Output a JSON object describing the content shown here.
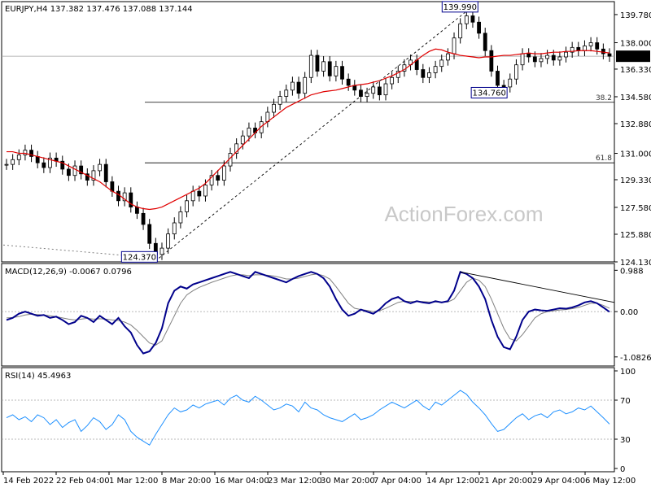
{
  "chart_data": [
    {
      "type": "candlestick",
      "header": "EURJPY,H4  137.382 137.476 137.088 137.144",
      "watermark": "ActionForex.com",
      "ylim": [
        124.13,
        140.6
      ],
      "y_ticks": [
        "139.780",
        "138.000",
        "136.330",
        "134.580",
        "132.880",
        "131.000",
        "129.330",
        "127.580",
        "125.880",
        "124.130"
      ],
      "last_price_label": "137.144",
      "last_price": 137.144,
      "annotations": [
        {
          "label": "139.990",
          "value": 139.99
        },
        {
          "label": "134.760",
          "value": 134.76
        },
        {
          "label": "124.370",
          "value": 124.37
        }
      ],
      "fib_levels": [
        {
          "label": "38.2",
          "value": 134.23
        },
        {
          "label": "61.8",
          "value": 130.4
        }
      ],
      "close_series": [
        130.3,
        130.6,
        130.9,
        131.2,
        130.8,
        130.4,
        130.1,
        130.7,
        130.5,
        130.0,
        129.6,
        130.2,
        129.7,
        129.3,
        129.9,
        130.3,
        129.2,
        128.6,
        128.0,
        128.5,
        127.6,
        127.2,
        126.5,
        125.3,
        124.6,
        125.0,
        125.9,
        126.6,
        127.3,
        128.0,
        128.6,
        128.3,
        129.0,
        129.6,
        129.3,
        130.2,
        131.0,
        131.6,
        132.1,
        132.6,
        132.3,
        133.0,
        133.6,
        134.1,
        134.6,
        135.0,
        135.5,
        134.8,
        135.8,
        137.2,
        136.2,
        136.8,
        135.9,
        136.5,
        135.7,
        135.3,
        135.0,
        134.6,
        134.8,
        135.2,
        134.7,
        135.4,
        135.8,
        136.2,
        136.6,
        136.9,
        136.3,
        135.8,
        136.1,
        136.5,
        136.9,
        137.3,
        138.3,
        139.2,
        139.7,
        139.3,
        138.6,
        137.5,
        136.2,
        135.3,
        135.2,
        135.7,
        136.6,
        137.3,
        137.1,
        136.8,
        137.0,
        137.2,
        136.9,
        137.1,
        137.4,
        137.7,
        137.5,
        137.8,
        138.0,
        137.6,
        137.3,
        137.144
      ],
      "ma_series": [
        131.1,
        131.1,
        131.0,
        131.0,
        130.9,
        130.8,
        130.7,
        130.6,
        130.5,
        130.4,
        130.2,
        130.0,
        129.8,
        129.6,
        129.4,
        129.2,
        128.9,
        128.6,
        128.4,
        128.1,
        127.8,
        127.6,
        127.5,
        127.45,
        127.5,
        127.6,
        127.8,
        128.0,
        128.2,
        128.4,
        128.6,
        128.8,
        129.1,
        129.5,
        129.9,
        130.3,
        130.7,
        131.1,
        131.5,
        131.9,
        132.3,
        132.7,
        133.0,
        133.3,
        133.6,
        133.9,
        134.1,
        134.3,
        134.5,
        134.7,
        134.8,
        134.9,
        134.95,
        135.0,
        135.1,
        135.2,
        135.3,
        135.35,
        135.4,
        135.5,
        135.6,
        135.75,
        135.9,
        136.1,
        136.3,
        136.6,
        136.9,
        137.2,
        137.45,
        137.6,
        137.55,
        137.4,
        137.3,
        137.2,
        137.15,
        137.1,
        137.05,
        137.1,
        137.1,
        137.15,
        137.2,
        137.2,
        137.25,
        137.3,
        137.35,
        137.3,
        137.3,
        137.35,
        137.4,
        137.4,
        137.45,
        137.45,
        137.5,
        137.5,
        137.5,
        137.45,
        137.4,
        137.35
      ]
    },
    {
      "type": "line",
      "header": "MACD(12,26,9) -0.0067 0.0796",
      "ylim": [
        -1.3,
        1.15
      ],
      "y_ticks": [
        {
          "label": "0.988",
          "value": 0.988
        },
        {
          "label": "0.00",
          "value": 0.0
        },
        {
          "label": "-1.0826",
          "value": -1.0826
        }
      ],
      "series": [
        {
          "values": [
            -0.2,
            -0.15,
            -0.05,
            0.0,
            -0.05,
            -0.1,
            -0.08,
            -0.15,
            -0.12,
            -0.2,
            -0.3,
            -0.25,
            -0.1,
            -0.15,
            -0.25,
            -0.1,
            -0.2,
            -0.3,
            -0.15,
            -0.35,
            -0.5,
            -0.8,
            -1.0,
            -0.95,
            -0.75,
            -0.4,
            0.2,
            0.5,
            0.6,
            0.55,
            0.65,
            0.7,
            0.75,
            0.8,
            0.85,
            0.9,
            0.95,
            0.9,
            0.85,
            0.8,
            0.95,
            0.9,
            0.85,
            0.8,
            0.75,
            0.7,
            0.78,
            0.85,
            0.9,
            0.95,
            0.9,
            0.8,
            0.6,
            0.3,
            0.05,
            -0.1,
            -0.05,
            0.05,
            0.0,
            -0.05,
            0.05,
            0.2,
            0.3,
            0.35,
            0.25,
            0.2,
            0.25,
            0.22,
            0.2,
            0.25,
            0.22,
            0.25,
            0.5,
            0.95,
            0.9,
            0.8,
            0.6,
            0.3,
            -0.2,
            -0.6,
            -0.85,
            -0.9,
            -0.6,
            -0.2,
            0.0,
            0.05,
            0.03,
            0.02,
            0.05,
            0.08,
            0.07,
            0.1,
            0.15,
            0.22,
            0.25,
            0.2,
            0.1,
            -0.0067
          ]
        },
        {
          "values": [
            -0.15,
            -0.14,
            -0.12,
            -0.08,
            -0.06,
            -0.07,
            -0.08,
            -0.1,
            -0.12,
            -0.15,
            -0.18,
            -0.2,
            -0.18,
            -0.16,
            -0.18,
            -0.17,
            -0.18,
            -0.2,
            -0.21,
            -0.25,
            -0.32,
            -0.45,
            -0.6,
            -0.75,
            -0.8,
            -0.7,
            -0.4,
            -0.1,
            0.2,
            0.4,
            0.5,
            0.58,
            0.64,
            0.7,
            0.75,
            0.8,
            0.85,
            0.88,
            0.88,
            0.86,
            0.88,
            0.88,
            0.87,
            0.85,
            0.82,
            0.78,
            0.78,
            0.8,
            0.84,
            0.88,
            0.9,
            0.86,
            0.78,
            0.6,
            0.4,
            0.2,
            0.08,
            0.05,
            0.03,
            0.0,
            0.02,
            0.08,
            0.15,
            0.22,
            0.25,
            0.24,
            0.24,
            0.24,
            0.23,
            0.23,
            0.23,
            0.23,
            0.3,
            0.5,
            0.7,
            0.8,
            0.75,
            0.6,
            0.3,
            -0.05,
            -0.4,
            -0.65,
            -0.7,
            -0.55,
            -0.35,
            -0.15,
            -0.05,
            0.0,
            0.02,
            0.04,
            0.05,
            0.07,
            0.1,
            0.15,
            0.2,
            0.2,
            0.15,
            0.0796
          ]
        }
      ]
    },
    {
      "type": "line",
      "header": "RSI(14) 45.4963",
      "ylim": [
        0,
        100
      ],
      "y_ticks": [
        {
          "label": "100",
          "value": 100
        },
        {
          "label": "70",
          "value": 70
        },
        {
          "label": "30",
          "value": 30
        },
        {
          "label": "0",
          "value": 0
        }
      ],
      "series": [
        {
          "values": [
            52,
            55,
            50,
            53,
            48,
            55,
            52,
            45,
            50,
            42,
            47,
            50,
            38,
            44,
            52,
            48,
            40,
            45,
            55,
            50,
            38,
            32,
            28,
            24,
            35,
            45,
            55,
            62,
            58,
            60,
            65,
            62,
            66,
            68,
            70,
            65,
            72,
            75,
            70,
            68,
            74,
            70,
            65,
            60,
            62,
            66,
            64,
            58,
            68,
            62,
            60,
            55,
            52,
            50,
            48,
            52,
            56,
            50,
            52,
            55,
            60,
            64,
            68,
            65,
            62,
            66,
            70,
            64,
            60,
            68,
            65,
            70,
            75,
            80,
            76,
            68,
            62,
            55,
            46,
            38,
            40,
            46,
            52,
            56,
            50,
            54,
            56,
            52,
            58,
            60,
            56,
            58,
            62,
            60,
            64,
            58,
            52,
            45.4963
          ]
        }
      ]
    }
  ],
  "x_axis": {
    "labels": [
      "14 Feb 2022",
      "22 Feb 04:00",
      "1 Mar 12:00",
      "8 Mar 20:00",
      "16 Mar 04:00",
      "23 Mar 12:00",
      "30 Mar 20:00",
      "7 Apr 04:00",
      "14 Apr 12:00",
      "21 Apr 20:00",
      "29 Apr 04:00",
      "6 May 12:00"
    ]
  },
  "colors": {
    "candle": "#000000",
    "ma": "#e00000",
    "macd": "#00008b",
    "signal": "#808080",
    "rsi": "#1e90ff",
    "dotted": "#808080",
    "trendline": "#000000"
  }
}
